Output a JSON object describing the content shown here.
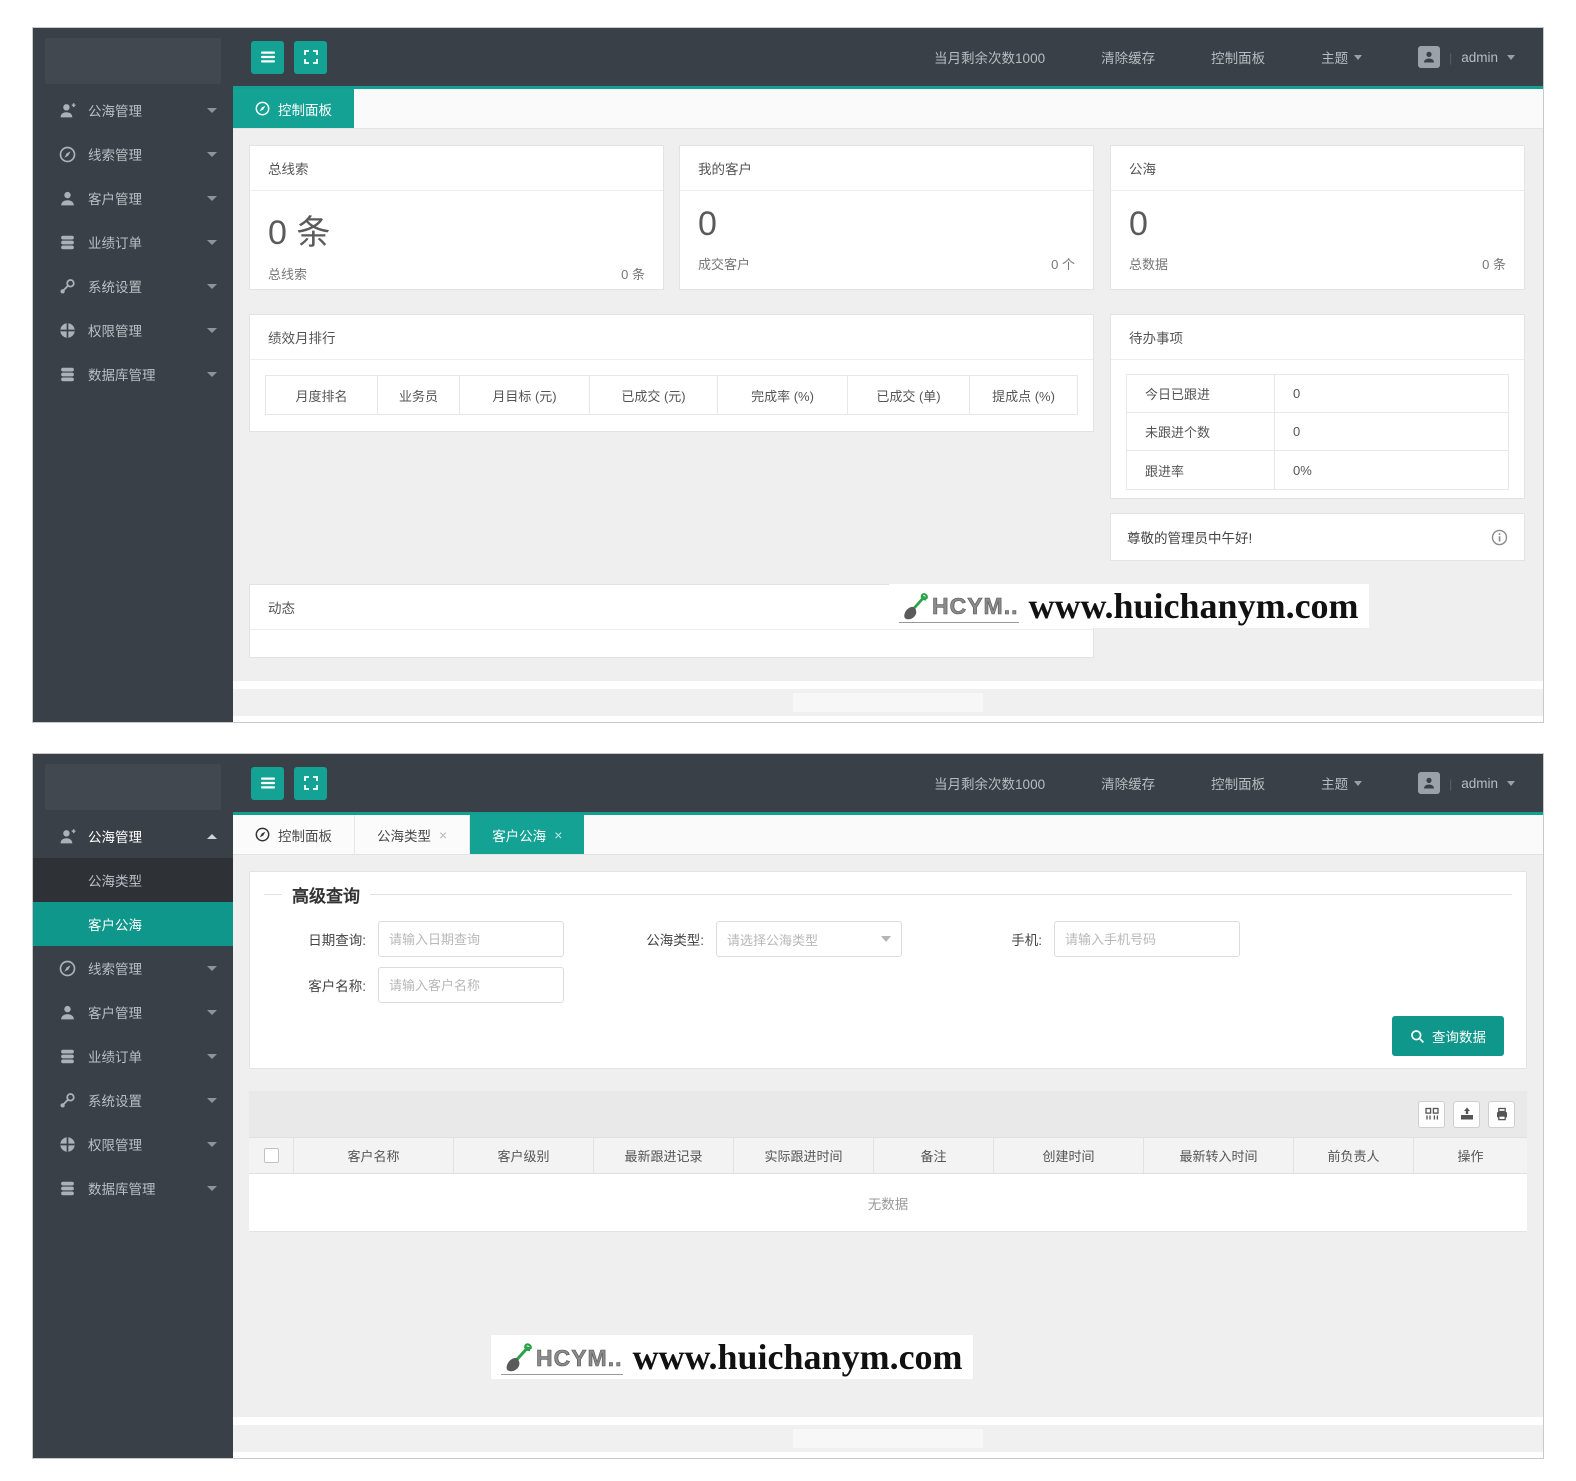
{
  "theme": {
    "accent_teal": "#11a091",
    "dark_bg": "#3a4047",
    "content_bg": "#efefef"
  },
  "topbar": {
    "remaining_count": "当月剩余次数1000",
    "clear_cache": "清除缓存",
    "control_panel": "控制面板",
    "theme_label": "主题",
    "username": "admin"
  },
  "sidebar": {
    "items": [
      {
        "label": "公海管理"
      },
      {
        "label": "线索管理"
      },
      {
        "label": "客户管理"
      },
      {
        "label": "业绩订单"
      },
      {
        "label": "系统设置"
      },
      {
        "label": "权限管理"
      },
      {
        "label": "数据库管理"
      }
    ],
    "submenu": [
      {
        "label": "公海类型"
      },
      {
        "label": "客户公海"
      }
    ]
  },
  "dashboard": {
    "tab": "控制面板",
    "stat_cards": [
      {
        "title": "总线索",
        "value": "0 条",
        "footer_label": "总线索",
        "footer_value": "0 条"
      },
      {
        "title": "我的客户",
        "value": "0",
        "footer_label": "成交客户",
        "footer_value": "0 个"
      },
      {
        "title": "公海",
        "value": "0",
        "footer_label": "总数据",
        "footer_value": "0 条"
      }
    ],
    "ranking": {
      "title": "绩效月排行",
      "columns": [
        "月度排名",
        "业务员",
        "月目标 (元)",
        "已成交 (元)",
        "完成率 (%)",
        "已成交 (单)",
        "提成点 (%)"
      ]
    },
    "todo": {
      "title": "待办事项",
      "rows": [
        {
          "label": "今日已跟进",
          "value": "0"
        },
        {
          "label": "未跟进个数",
          "value": "0"
        },
        {
          "label": "跟进率",
          "value": "0%"
        }
      ]
    },
    "greeting": "尊敬的管理员中午好!",
    "feed_title": "动态"
  },
  "pool": {
    "tabs": [
      {
        "label": "控制面板"
      },
      {
        "label": "公海类型"
      },
      {
        "label": "客户公海"
      }
    ],
    "query": {
      "legend": "高级查询",
      "date_label": "日期查询:",
      "date_placeholder": "请输入日期查询",
      "type_label": "公海类型:",
      "type_placeholder": "请选择公海类型",
      "phone_label": "手机:",
      "phone_placeholder": "请输入手机号码",
      "name_label": "客户名称:",
      "name_placeholder": "请输入客户名称",
      "search_button": "查询数据"
    },
    "table": {
      "columns": [
        "客户名称",
        "客户级别",
        "最新跟进记录",
        "实际跟进时间",
        "备注",
        "创建时间",
        "最新转入时间",
        "前负责人",
        "操作"
      ],
      "empty_text": "无数据"
    }
  },
  "watermark": {
    "brand": "HCYM..",
    "site": "www.huichanym.com"
  }
}
